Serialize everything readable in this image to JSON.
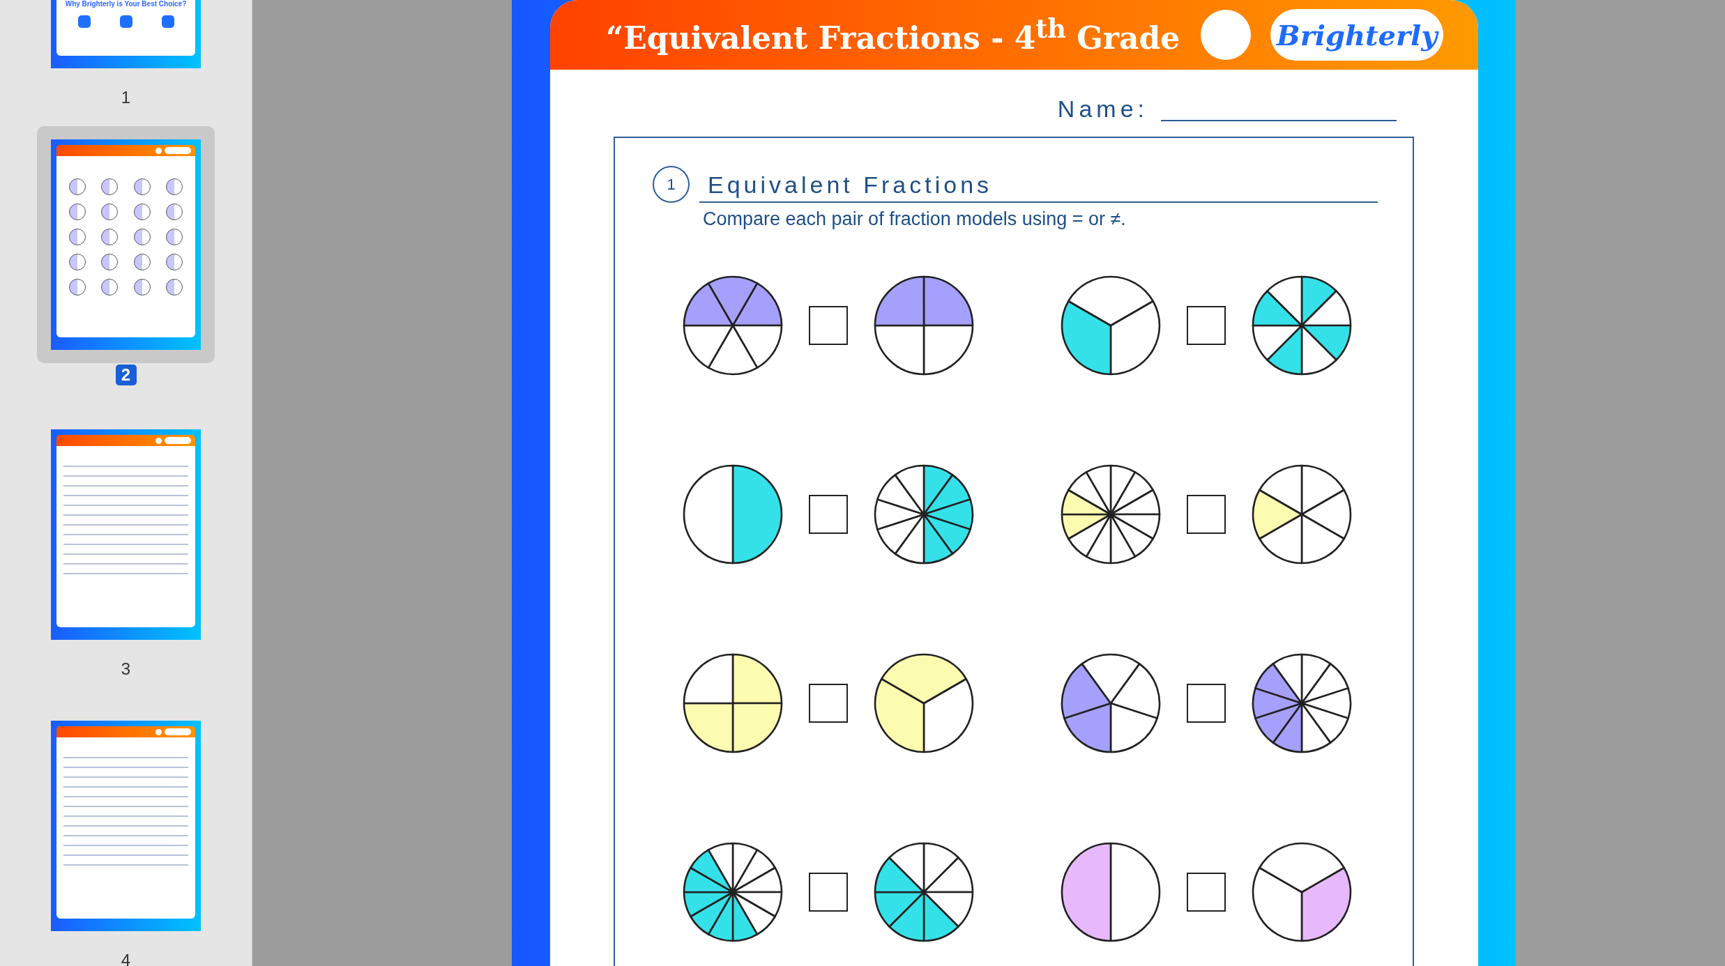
{
  "sidebar": {
    "pages": [
      {
        "number": "1",
        "selected": false,
        "heading": "Why Brighterly is Your Best Choice?"
      },
      {
        "number": "2",
        "selected": true
      },
      {
        "number": "3",
        "selected": false
      },
      {
        "number": "4",
        "selected": false
      }
    ]
  },
  "worksheet": {
    "title": "“Equivalent Fractions - 4$^{th}$ Grade",
    "logo": "Brighterly",
    "name_label": "Name:",
    "section": {
      "number": "1",
      "heading": "Equivalent Fractions",
      "instruction": "Compare each pair of fraction models using = or ≠."
    },
    "pairs": [
      {
        "color": "#a5a0fb",
        "left": [
          true,
          false,
          false,
          false,
          true,
          true
        ],
        "right": [
          true,
          false,
          false,
          true
        ]
      },
      {
        "color": "#35e1e8",
        "left": [
          false,
          true,
          false
        ],
        "right": [
          true,
          false,
          true,
          false,
          true,
          false,
          true,
          false
        ]
      },
      {
        "color": "#35e1e8",
        "left": [
          true,
          false
        ],
        "right": [
          true,
          true,
          true,
          true,
          true,
          false,
          false,
          false,
          false,
          false
        ]
      },
      {
        "color": "#fcfcb0",
        "left": [
          false,
          false,
          false,
          false,
          false,
          false,
          false,
          false,
          true,
          true,
          false,
          false
        ],
        "right": [
          false,
          false,
          false,
          false,
          true,
          false
        ]
      },
      {
        "color": "#fcfcb0",
        "left": [
          true,
          true,
          true,
          false
        ],
        "right": [
          false,
          true,
          true
        ]
      },
      {
        "color": "#a5a0fb",
        "left": [
          false,
          false,
          true,
          true,
          false
        ],
        "right": [
          false,
          false,
          false,
          false,
          false,
          true,
          true,
          true,
          true,
          false
        ]
      },
      {
        "color": "#35e1e8",
        "left": [
          false,
          false,
          false,
          false,
          false,
          true,
          true,
          true,
          true,
          true,
          true,
          false
        ],
        "right": [
          false,
          false,
          false,
          true,
          true,
          true,
          true,
          false
        ]
      },
      {
        "color": "#e8b8fc",
        "left": [
          false,
          true
        ],
        "right": [
          true,
          false,
          false
        ]
      }
    ]
  }
}
